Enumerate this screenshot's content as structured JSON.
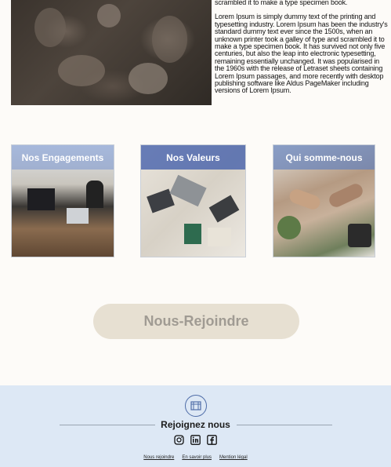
{
  "hero": {
    "top_line": "scrambled it to make a type specimen book.",
    "paragraph": "Lorem Ipsum is simply dummy text of the printing and typesetting industry. Lorem Ipsum has been the industry's standard dummy text ever since the 1500s, when an unknown printer took a galley of type and scrambled it to make a type specimen book. It has survived not only five centuries, but also the leap into electronic typesetting, remaining essentially unchanged. It was popularised in the 1960s with the release of Letraset sheets containing Lorem Ipsum passages, and more recently with desktop publishing software like Aldus PageMaker including versions of Lorem Ipsum."
  },
  "cards": [
    {
      "label": "Nos Engagements"
    },
    {
      "label": "Nos Valeurs"
    },
    {
      "label": "Qui somme-nous"
    }
  ],
  "cta": {
    "label": "Nous-Rejoindre"
  },
  "footer": {
    "title": "Rejoignez nous",
    "social": [
      "instagram-icon",
      "linkedin-icon",
      "facebook-icon"
    ],
    "links": [
      "Nous rejoindre",
      "En savoir plus",
      "Mention légal"
    ]
  },
  "colors": {
    "footer_bg": "#dde8f5",
    "cta_bg": "#e7e0d2",
    "cta_text": "#a09b93",
    "accent": "#4f6da8"
  }
}
